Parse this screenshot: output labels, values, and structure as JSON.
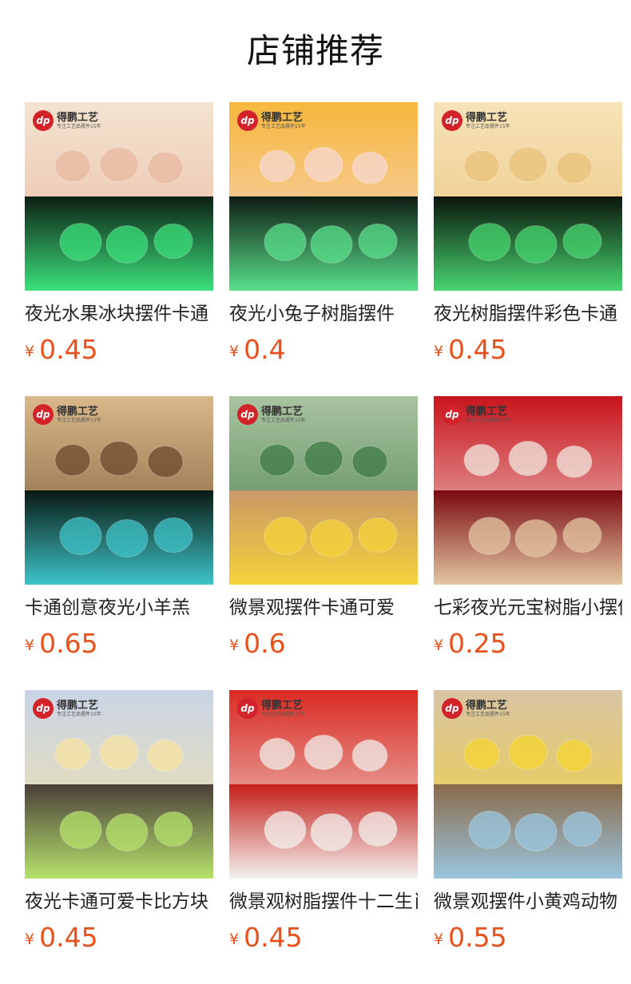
{
  "page": {
    "title": "店铺推荐"
  },
  "logo": {
    "mark": "dp",
    "brand": "得鹏工艺",
    "tagline": "专注工艺品摆件15年"
  },
  "currency_symbol": "¥",
  "products": [
    {
      "name": "夜光水果冰块摆件卡通",
      "price": "0.45",
      "top_colors": [
        "#f3e3d0",
        "#e9b9a0"
      ],
      "bottom_colors": [
        "#0d1f14",
        "#3be07a"
      ]
    },
    {
      "name": "夜光小兔子树脂摆件",
      "price": "0.4",
      "top_colors": [
        "#f6b73c",
        "#f7d9d3"
      ],
      "bottom_colors": [
        "#0e1c12",
        "#59e08b"
      ]
    },
    {
      "name": "夜光树脂摆件彩色卡通",
      "price": "0.45",
      "top_colors": [
        "#f7e3b7",
        "#e8c27a"
      ],
      "bottom_colors": [
        "#0b140c",
        "#47d56f"
      ]
    },
    {
      "name": "卡通创意夜光小羊羔",
      "price": "0.65",
      "top_colors": [
        "#d9b98a",
        "#6e4a2d"
      ],
      "bottom_colors": [
        "#0a1a12",
        "#3ec3c8"
      ]
    },
    {
      "name": "微景观摆件卡通可爱",
      "price": "0.6",
      "top_colors": [
        "#a9c3a0",
        "#3f7a46"
      ],
      "bottom_colors": [
        "#c89867",
        "#f5d23a"
      ]
    },
    {
      "name": "七彩夜光元宝树脂小摆件",
      "price": "0.25",
      "top_colors": [
        "#c8141c",
        "#f2e8e0"
      ],
      "bottom_colors": [
        "#7a0a10",
        "#e4c6a2"
      ]
    },
    {
      "name": "夜光卡通可爱卡比方块",
      "price": "0.45",
      "top_colors": [
        "#c9d4e6",
        "#f7e3a1"
      ],
      "bottom_colors": [
        "#4b3f3a",
        "#b6e26b"
      ]
    },
    {
      "name": "微景观树脂摆件十二生肖",
      "price": "0.45",
      "top_colors": [
        "#d92a22",
        "#f1efe9"
      ],
      "bottom_colors": [
        "#c51f1a",
        "#f3f1ee"
      ]
    },
    {
      "name": "微景观摆件小黄鸡动物",
      "price": "0.55",
      "top_colors": [
        "#d8c3a3",
        "#f5d531"
      ],
      "bottom_colors": [
        "#8a6a4a",
        "#9ac6df"
      ]
    }
  ]
}
